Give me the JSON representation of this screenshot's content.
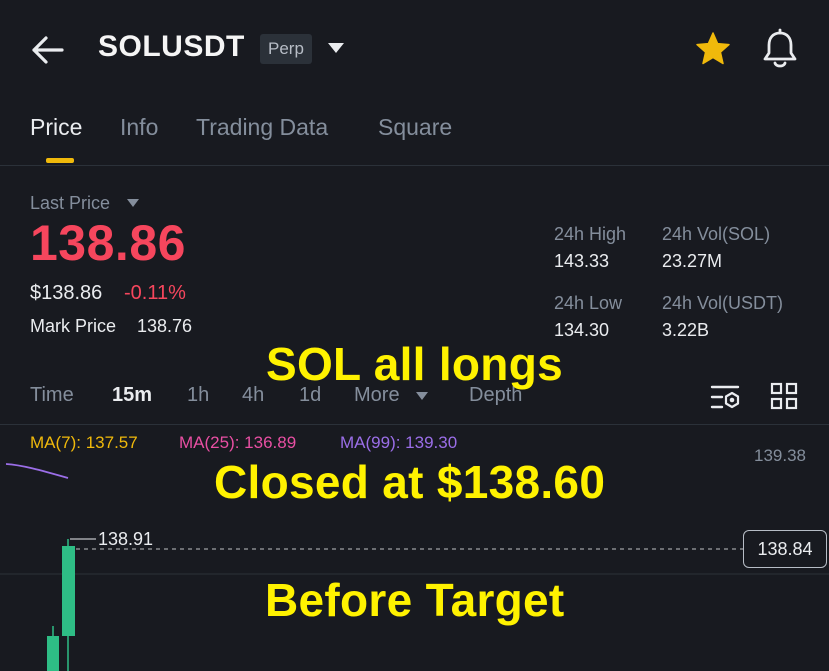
{
  "header": {
    "symbol": "SOLUSDT",
    "contract_type": "Perp"
  },
  "tabs": [
    {
      "label": "Price",
      "active": true
    },
    {
      "label": "Info",
      "active": false
    },
    {
      "label": "Trading Data",
      "active": false
    },
    {
      "label": "Square",
      "active": false
    }
  ],
  "price": {
    "last_price_label": "Last Price",
    "last_price": "138.86",
    "usd_price": "$138.86",
    "change_pct": "-0.11%",
    "mark_price_label": "Mark Price",
    "mark_price": "138.76"
  },
  "stats": {
    "high_label": "24h High",
    "high_value": "143.33",
    "low_label": "24h Low",
    "low_value": "134.30",
    "vol_base_label": "24h Vol(SOL)",
    "vol_base_value": "23.27M",
    "vol_quote_label": "24h Vol(USDT)",
    "vol_quote_value": "3.22B"
  },
  "timeframes": {
    "time": "Time",
    "m15": "15m",
    "h1": "1h",
    "h4": "4h",
    "d1": "1d",
    "more": "More",
    "depth": "Depth",
    "active": "15m"
  },
  "indicators": {
    "ma7": "MA(7): 137.57",
    "ma25": "MA(25): 136.89",
    "ma99": "MA(99): 139.30"
  },
  "chart": {
    "axis_top": "139.38",
    "high_marker": "138.91",
    "current_price": "138.84"
  },
  "overlay": {
    "line1": "SOL all longs",
    "line2": "Closed at $138.60",
    "line3": "Before Target"
  },
  "colors": {
    "background": "#181a20",
    "accent": "#f0b90b",
    "down": "#f6465d",
    "up": "#2ebd85",
    "ma7": "#f0b90b",
    "ma25": "#e84fa3",
    "ma99": "#9b6ee8",
    "caption": "#fff200"
  },
  "icons": [
    "back-arrow-icon",
    "caret-down-icon",
    "star-icon",
    "bell-icon",
    "indicator-settings-icon",
    "grid-icon"
  ]
}
